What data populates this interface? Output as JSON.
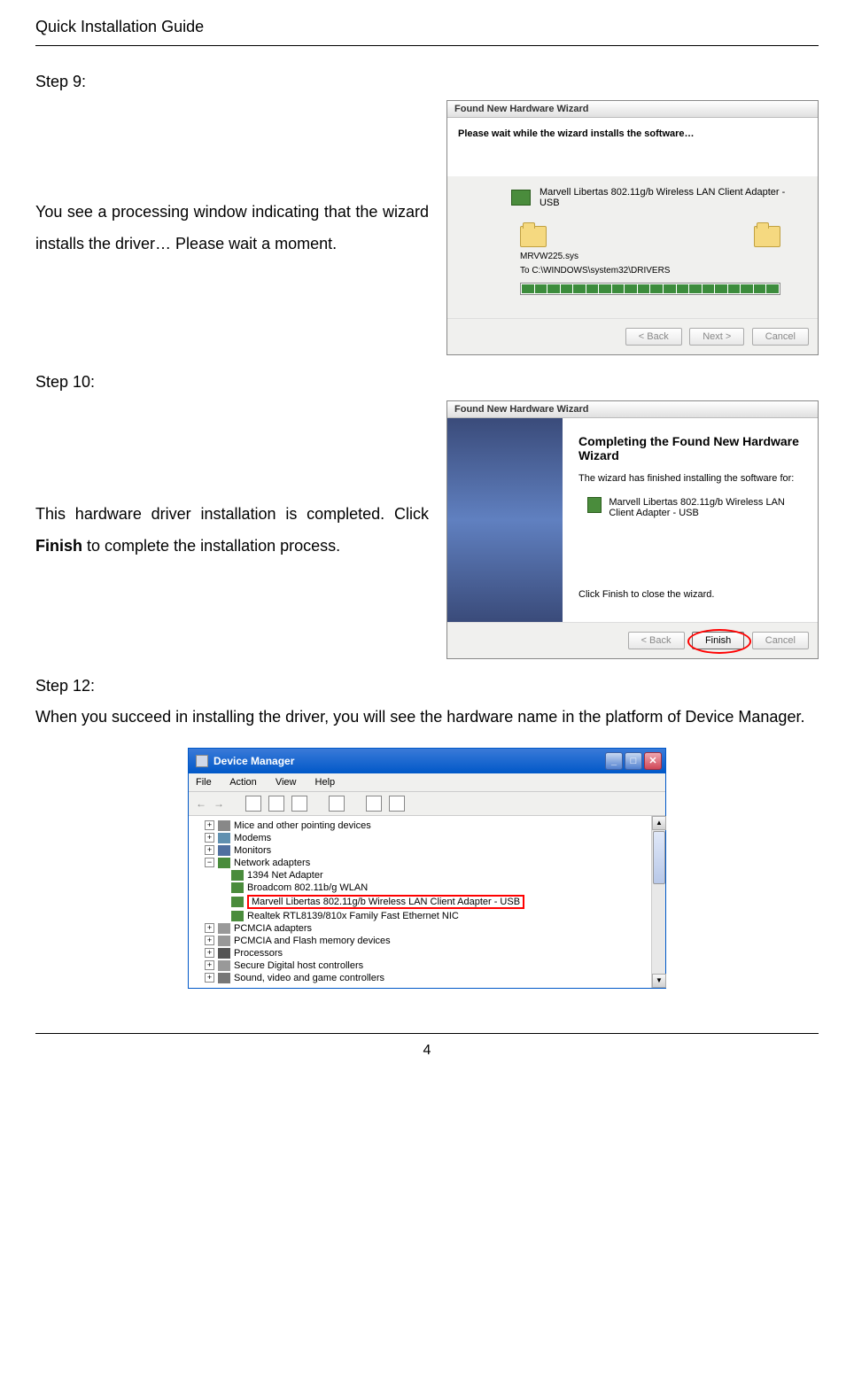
{
  "header": {
    "title": "Quick Installation Guide"
  },
  "step9": {
    "label": "Step 9:",
    "text": "You see a processing window indicating that the wizard installs the driver… Please wait a moment.",
    "wizard": {
      "title": "Found New Hardware Wizard",
      "instruction": "Please wait while the wizard installs the software…",
      "device": "Marvell Libertas 802.11g/b Wireless LAN Client Adapter - USB",
      "file": "MRVW225.sys",
      "path": "To C:\\WINDOWS\\system32\\DRIVERS",
      "buttons": {
        "back": "< Back",
        "next": "Next >",
        "cancel": "Cancel"
      }
    }
  },
  "step10": {
    "label": "Step 10:",
    "text_pre": "This hardware driver installation is completed. Click ",
    "text_bold": "Finish",
    "text_post": " to complete the installation process.",
    "wizard": {
      "title": "Found New Hardware Wizard",
      "heading": "Completing the Found New Hardware Wizard",
      "subtext": "The wizard has finished installing the software for:",
      "device": "Marvell Libertas 802.11g/b Wireless LAN Client Adapter - USB",
      "hint": "Click Finish to close the wizard.",
      "buttons": {
        "back": "< Back",
        "finish": "Finish",
        "cancel": "Cancel"
      }
    }
  },
  "step12": {
    "label": "Step 12:",
    "text": "When you succeed in installing the driver, you will see the hardware name in the platform of Device Manager.",
    "devmgr": {
      "title": "Device Manager",
      "menu": [
        "File",
        "Action",
        "View",
        "Help"
      ],
      "tree": {
        "mice": "Mice and other pointing devices",
        "modems": "Modems",
        "monitors": "Monitors",
        "network": "Network adapters",
        "net_children": [
          "1394 Net Adapter",
          "Broadcom 802.11b/g WLAN",
          "Marvell Libertas 802.11g/b Wireless LAN Client Adapter - USB",
          "Realtek RTL8139/810x Family Fast Ethernet NIC"
        ],
        "pcmcia": "PCMCIA adapters",
        "pcmcia_flash": "PCMCIA and Flash memory devices",
        "processors": "Processors",
        "sd": "Secure Digital host controllers",
        "sound": "Sound, video and game controllers"
      }
    }
  },
  "footer": {
    "page": "4"
  }
}
